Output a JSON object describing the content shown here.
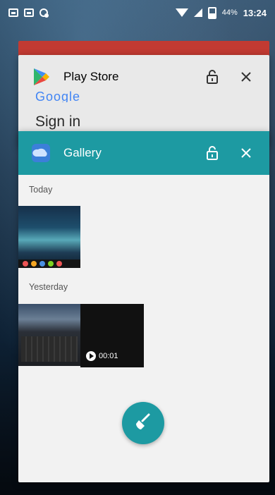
{
  "status_bar": {
    "battery_percent": "44%",
    "time": "13:24"
  },
  "recent_apps": [
    {
      "app_name": "Play Store",
      "preview_logo_text": "Google",
      "preview_text": "Sign in"
    },
    {
      "app_name": "Gallery",
      "sections": [
        {
          "label": "Today"
        },
        {
          "label": "Yesterday"
        }
      ],
      "video_duration": "00:01",
      "header_color": "#1d9aa2"
    }
  ],
  "icons": {
    "notification_1": "image-notification-icon",
    "notification_2": "image-notification-icon",
    "notification_3": "screenshot-notification-icon",
    "wifi": "wifi-icon",
    "signal": "cell-signal-icon",
    "battery": "battery-icon",
    "play_store": "play-store-icon",
    "gallery": "gallery-icon",
    "lock": "lock-icon",
    "close": "close-icon",
    "clear_all": "broom-icon"
  }
}
